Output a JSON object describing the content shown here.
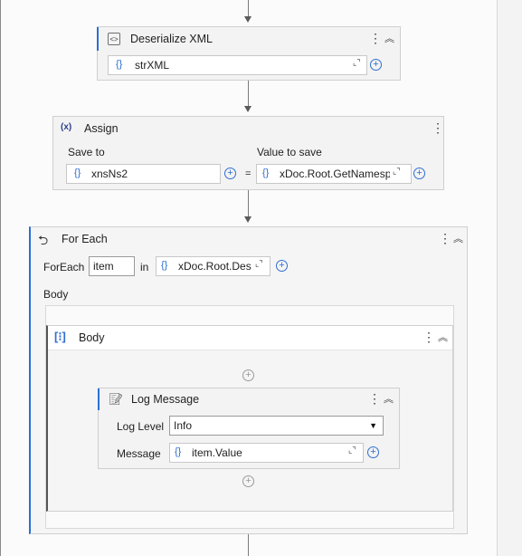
{
  "deserialize": {
    "title": "Deserialize XML",
    "input_brace": "{}",
    "input_value": "strXML"
  },
  "assign": {
    "title": "Assign",
    "icon_text": "(x)",
    "save_to_label": "Save to",
    "value_label": "Value to save",
    "save_to_value": "xnsNs2",
    "equals": "=",
    "value_expression": "xDoc.Root.GetNamesp"
  },
  "foreach": {
    "title": "For Each",
    "foreach_label": "ForEach",
    "item_value": "item",
    "in_label": "in",
    "collection_expression": "xDoc.Root.Des",
    "body_label": "Body",
    "body_sequence": {
      "title": "Body",
      "log_message": {
        "title": "Log Message",
        "level_label": "Log Level",
        "level_value": "Info",
        "message_label": "Message",
        "message_value": "item.Value"
      }
    }
  },
  "colors": {
    "accent": "#2b6fd6",
    "connector": "#7a7a7a",
    "card_bg": "#f3f3f3"
  },
  "icons": {
    "deserialize": "code-brackets-icon",
    "assign": "variable-x-icon",
    "foreach": "loop-icon",
    "body": "sequence-icon",
    "log_message": "log-message-icon"
  }
}
